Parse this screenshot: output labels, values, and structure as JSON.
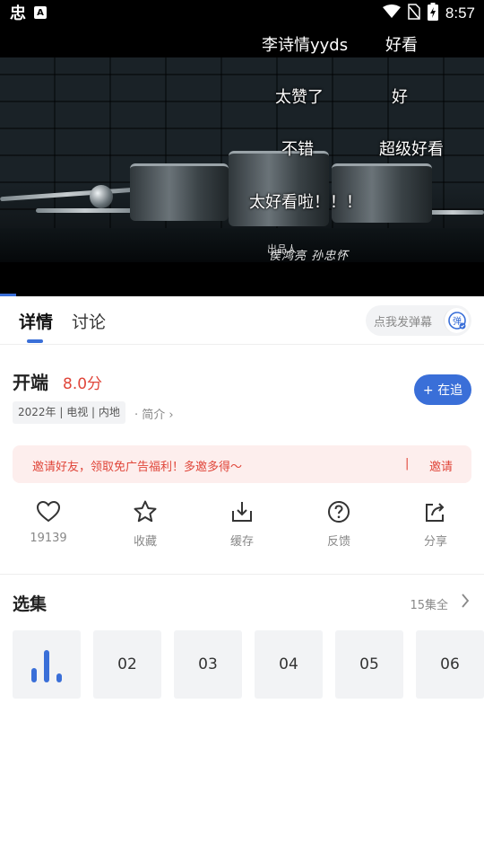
{
  "status_bar": {
    "app_icon": "忠",
    "notif_icon": "A",
    "time": "8:57",
    "icons": [
      "wifi-icon",
      "no-sim-icon",
      "battery-charging-icon"
    ]
  },
  "player": {
    "danmaku": [
      {
        "text": "李诗情yyds"
      },
      {
        "text": "好看"
      },
      {
        "text": "太赞了"
      },
      {
        "text": "好"
      },
      {
        "text": "不错"
      },
      {
        "text": "超级好看"
      },
      {
        "text": "太好看啦！！！"
      }
    ],
    "credit_small": "出品人",
    "credit": "侯鸿亮  孙忠怀"
  },
  "tabs": {
    "items": [
      {
        "label": "详情",
        "active": true
      },
      {
        "label": "讨论",
        "active": false
      }
    ],
    "danmaku_placeholder": "点我发弹幕",
    "danmaku_btn": "弹"
  },
  "show": {
    "title": "开端",
    "score": "8.0分",
    "meta": "2022年 | 电视 | 内地",
    "intro": "· 简介",
    "follow_label": "+ 在追"
  },
  "invite": {
    "text": "邀请好友，领取免广告福利！多邀多得～",
    "separator": "|",
    "button": "邀请"
  },
  "actions": [
    {
      "label": "19139",
      "icon": "heart-icon"
    },
    {
      "label": "收藏",
      "icon": "star-icon"
    },
    {
      "label": "缓存",
      "icon": "download-icon"
    },
    {
      "label": "反馈",
      "icon": "question-icon"
    },
    {
      "label": "分享",
      "icon": "share-icon"
    }
  ],
  "episodes": {
    "title": "选集",
    "total": "15集全",
    "items": [
      {
        "label": "",
        "playing": true
      },
      {
        "label": "02"
      },
      {
        "label": "03"
      },
      {
        "label": "04"
      },
      {
        "label": "05"
      },
      {
        "label": "06"
      }
    ]
  },
  "colors": {
    "accent": "#3a6fd8",
    "score": "#e0463a",
    "invite_bg": "#fdeeed"
  }
}
